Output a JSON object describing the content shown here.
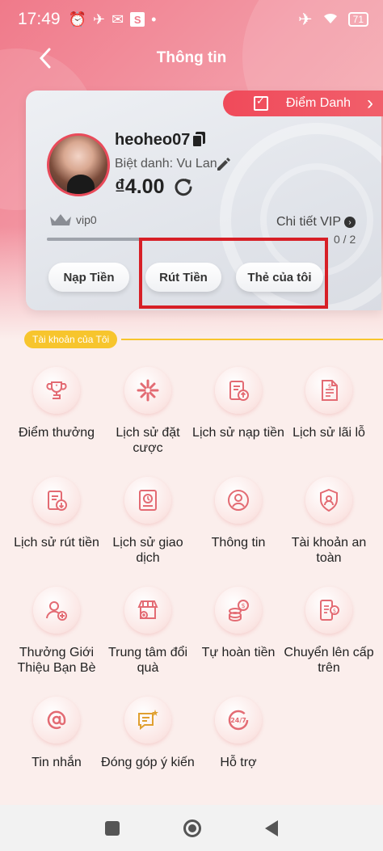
{
  "status_bar": {
    "time": "17:49",
    "battery": "71"
  },
  "header": {
    "title": "Thông tin"
  },
  "checkin": {
    "label": "Điểm Danh"
  },
  "profile": {
    "username": "heoheo07",
    "nickname": "Biệt danh: Vu Lan",
    "balance": "₫4.00",
    "vip_level": "vip0",
    "vip_detail": "Chi tiết VIP",
    "vip_progress": "0 / 2",
    "vip_progress_fraction": 0.35
  },
  "actions": {
    "deposit": "Nạp Tiền",
    "withdraw": "Rút Tiền",
    "my_card": "Thẻ của tôi"
  },
  "section": {
    "title": "Tài khoản của Tôi"
  },
  "menu": [
    {
      "label": "Điểm thưởng",
      "icon": "trophy-icon"
    },
    {
      "label": "Lịch sử đặt cược",
      "icon": "bet-history-icon"
    },
    {
      "label": "Lịch sử nạp tiền",
      "icon": "deposit-history-icon"
    },
    {
      "label": "Lịch sử lãi lỗ",
      "icon": "profit-loss-icon"
    },
    {
      "label": "Lịch sử rút tiền",
      "icon": "withdraw-history-icon"
    },
    {
      "label": "Lịch sử giao dịch",
      "icon": "transaction-history-icon"
    },
    {
      "label": "Thông tin",
      "icon": "user-info-icon"
    },
    {
      "label": "Tài khoản an toàn",
      "icon": "shield-icon"
    },
    {
      "label": "Thưởng Giới Thiệu Bạn Bè",
      "icon": "referral-icon"
    },
    {
      "label": "Trung tâm đổi quà",
      "icon": "gift-store-icon"
    },
    {
      "label": "Tự hoàn tiền",
      "icon": "cashback-icon"
    },
    {
      "label": "Chuyển lên cấp trên",
      "icon": "transfer-icon"
    },
    {
      "label": "Tin nhắn",
      "icon": "at-icon"
    },
    {
      "label": "Đóng góp ý kiến",
      "icon": "feedback-icon"
    },
    {
      "label": "Hỗ trợ",
      "icon": "support-24-7-icon"
    }
  ],
  "colors": {
    "accent": "#e94a5a",
    "tag": "#f7c52d",
    "highlight": "#d71f26"
  }
}
